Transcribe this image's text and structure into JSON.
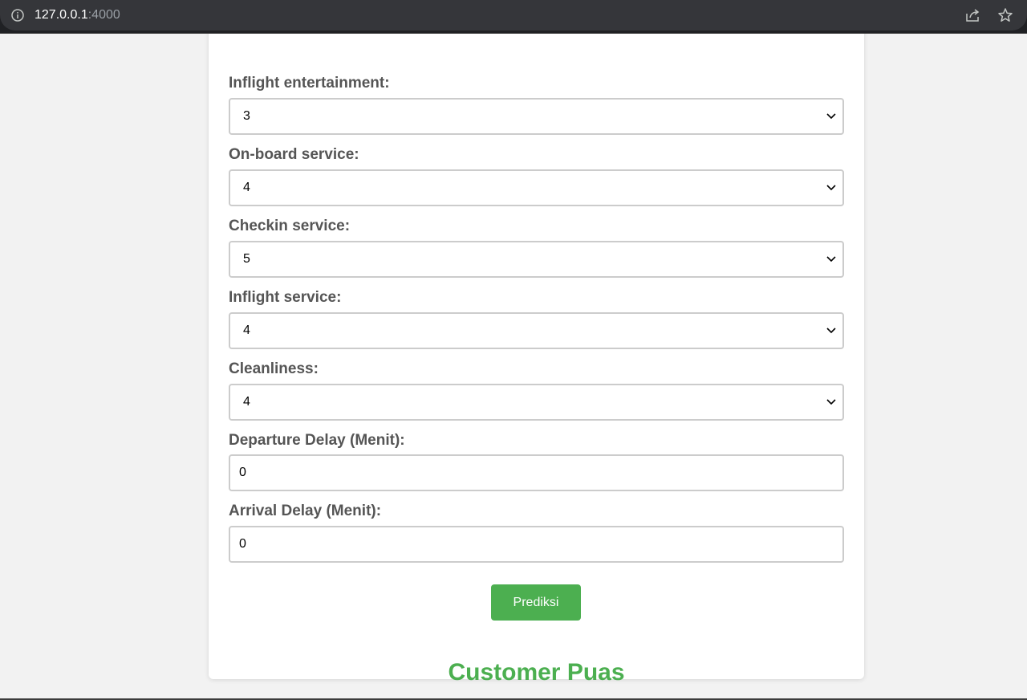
{
  "browser": {
    "host": "127.0.0.1",
    "port": ":4000"
  },
  "form": {
    "fields": [
      {
        "label": "Inflight entertainment:",
        "value": "3",
        "type": "select"
      },
      {
        "label": "On-board service:",
        "value": "4",
        "type": "select"
      },
      {
        "label": "Checkin service:",
        "value": "5",
        "type": "select"
      },
      {
        "label": "Inflight service:",
        "value": "4",
        "type": "select"
      },
      {
        "label": "Cleanliness:",
        "value": "4",
        "type": "select"
      },
      {
        "label": "Departure Delay (Menit):",
        "value": "0",
        "type": "input"
      },
      {
        "label": "Arrival Delay (Menit):",
        "value": "0",
        "type": "input"
      }
    ],
    "submit_label": "Prediksi",
    "result_text": "Customer Puas"
  },
  "colors": {
    "accent": "#4caf50",
    "label": "#555555",
    "border": "#cccccc"
  },
  "icons": {
    "info": "info-icon",
    "share": "share-icon",
    "bookmark": "star-icon",
    "dropdown": "chevron-down-icon"
  }
}
